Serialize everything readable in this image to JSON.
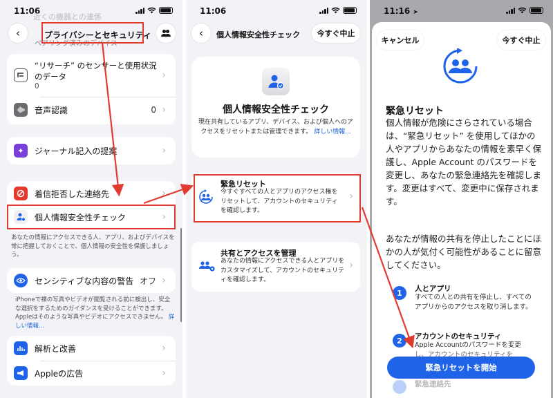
{
  "panel1": {
    "time": "11:06",
    "top_faded": "近くの機器との連係",
    "top_faded2": "ペアリング済みのデバイス",
    "nav_title": "プライバシーとセキュリティ",
    "research_label_1": "“リサーチ” のセンサーと使用状況",
    "research_label_2": "のデータ",
    "research_count": "0",
    "speech_label": "音声認識",
    "speech_count": "0",
    "journal_label": "ジャーナル記入の提案",
    "blocked_label": "着信拒否した連絡先",
    "safety_label": "個人情報安全性チェック",
    "safety_note": "あなたの情報にアクセスできる人、アプリ、およびデバイスを常に把握しておくことで、個人情報の安全性を保護しましょう。",
    "sensitive_label": "センシティブな内容の警告",
    "sensitive_value": "オフ",
    "sensitive_note": "iPhoneで裸の写真やビデオが閲覧される前に検出し、安全な選択をするためのガイダンスを受けることができます。Appleはそのような写真やビデオにアクセスできません。",
    "sensitive_link": "詳しい情報...",
    "analytics_label": "解析と改善",
    "ads_label": "Appleの広告"
  },
  "panel2": {
    "time": "11:06",
    "nav_title": "個人情報安全性チェック",
    "stop_label": "今すぐ中止",
    "hero_title": "個人情報安全性チェック",
    "hero_desc": "現在共有しているアプリ、デバイス、および個人へのアクセスをリセットまたは管理できます。",
    "hero_link": "詳しい情報...",
    "emergency_title": "緊急リセット",
    "emergency_desc": "今すぐすべての人とアプリのアクセス権をリセットして、アカウントのセキュリティを確認します。",
    "manage_title": "共有とアクセスを管理",
    "manage_desc": "あなたの情報にアクセスできる人とアプリをカスタマイズして、アカウントのセキュリティを確認します。"
  },
  "panel3": {
    "time": "11:16",
    "cancel_label": "キャンセル",
    "stop_label": "今すぐ中止",
    "title": "緊急リセット",
    "body1": "個人情報が危険にさらされている場合は、“緊急リセット” を使用してほかの人やアプリからあなたの情報を素早く保護し、Apple Account のパスワードを変更し、あなたの緊急連絡先を確認します。変更はすべて、変更中に保存されます。",
    "body2": "あなたが情報の共有を停止したことにほかの人が気付く可能性があることに留意してください。",
    "step1_num": "1",
    "step1_title": "人とアプリ",
    "step1_desc": "すべての人との共有を停止し、すべてのアプリからのアクセスを取り消します。",
    "step2_num": "2",
    "step2_title": "アカウントのセキュリティ",
    "step2_desc": "Apple Accountのパスワードを変更し、アカウントのセキュリティを",
    "step3_title": "緊急連絡先",
    "start_button": "緊急リセットを開始"
  },
  "colors": {
    "accent": "#1f64e8",
    "highlight": "#e13b2f",
    "group_bg": "#f2f2f7"
  }
}
